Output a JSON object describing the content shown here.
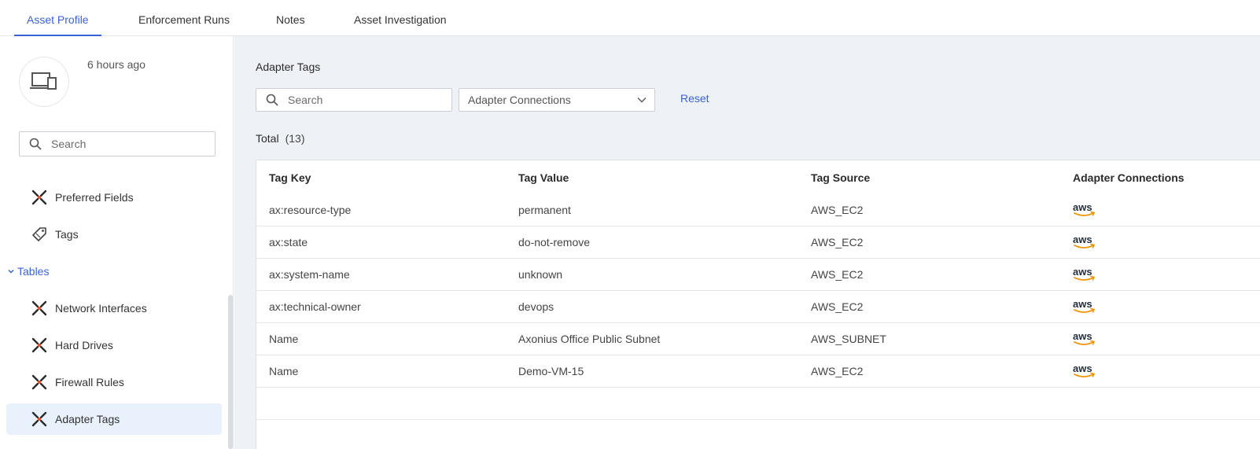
{
  "tabs": [
    {
      "label": "Asset Profile",
      "active": true
    },
    {
      "label": "Enforcement Runs",
      "active": false
    },
    {
      "label": "Notes",
      "active": false
    },
    {
      "label": "Asset Investigation",
      "active": false
    }
  ],
  "sidebar": {
    "avatar_icon": "devices-icon",
    "timestamp": "6 hours ago",
    "search_placeholder": "Search",
    "items": [
      {
        "label": "Preferred Fields",
        "icon": "axonius-x-icon"
      },
      {
        "label": "Tags",
        "icon": "tag-icon"
      }
    ],
    "section": {
      "label": "Tables",
      "expanded": true
    },
    "table_items": [
      {
        "label": "Network Interfaces",
        "icon": "axonius-x-icon"
      },
      {
        "label": "Hard Drives",
        "icon": "axonius-x-icon"
      },
      {
        "label": "Firewall Rules",
        "icon": "axonius-x-icon"
      },
      {
        "label": "Adapter Tags",
        "icon": "axonius-x-icon",
        "selected": true
      }
    ]
  },
  "main": {
    "title": "Adapter Tags",
    "search_placeholder": "Search",
    "dropdown_label": "Adapter Connections",
    "reset_label": "Reset",
    "total_label": "Total",
    "total_count": "(13)",
    "columns": [
      "Tag Key",
      "Tag Value",
      "Tag Source",
      "Adapter Connections"
    ],
    "rows": [
      {
        "key": "ax:resource-type",
        "value": "permanent",
        "source": "AWS_EC2",
        "connection": "aws"
      },
      {
        "key": "ax:state",
        "value": "do-not-remove",
        "source": "AWS_EC2",
        "connection": "aws"
      },
      {
        "key": "ax:system-name",
        "value": "unknown",
        "source": "AWS_EC2",
        "connection": "aws"
      },
      {
        "key": "ax:technical-owner",
        "value": "devops",
        "source": "AWS_EC2",
        "connection": "aws"
      },
      {
        "key": "Name",
        "value": "Axonius Office Public Subnet",
        "source": "AWS_SUBNET",
        "connection": "aws"
      },
      {
        "key": "Name",
        "value": "Demo-VM-15",
        "source": "AWS_EC2",
        "connection": "aws"
      }
    ]
  },
  "colors": {
    "accent": "#3a63d6",
    "aws_orange": "#f29100",
    "axonius_red": "#e8502d"
  }
}
